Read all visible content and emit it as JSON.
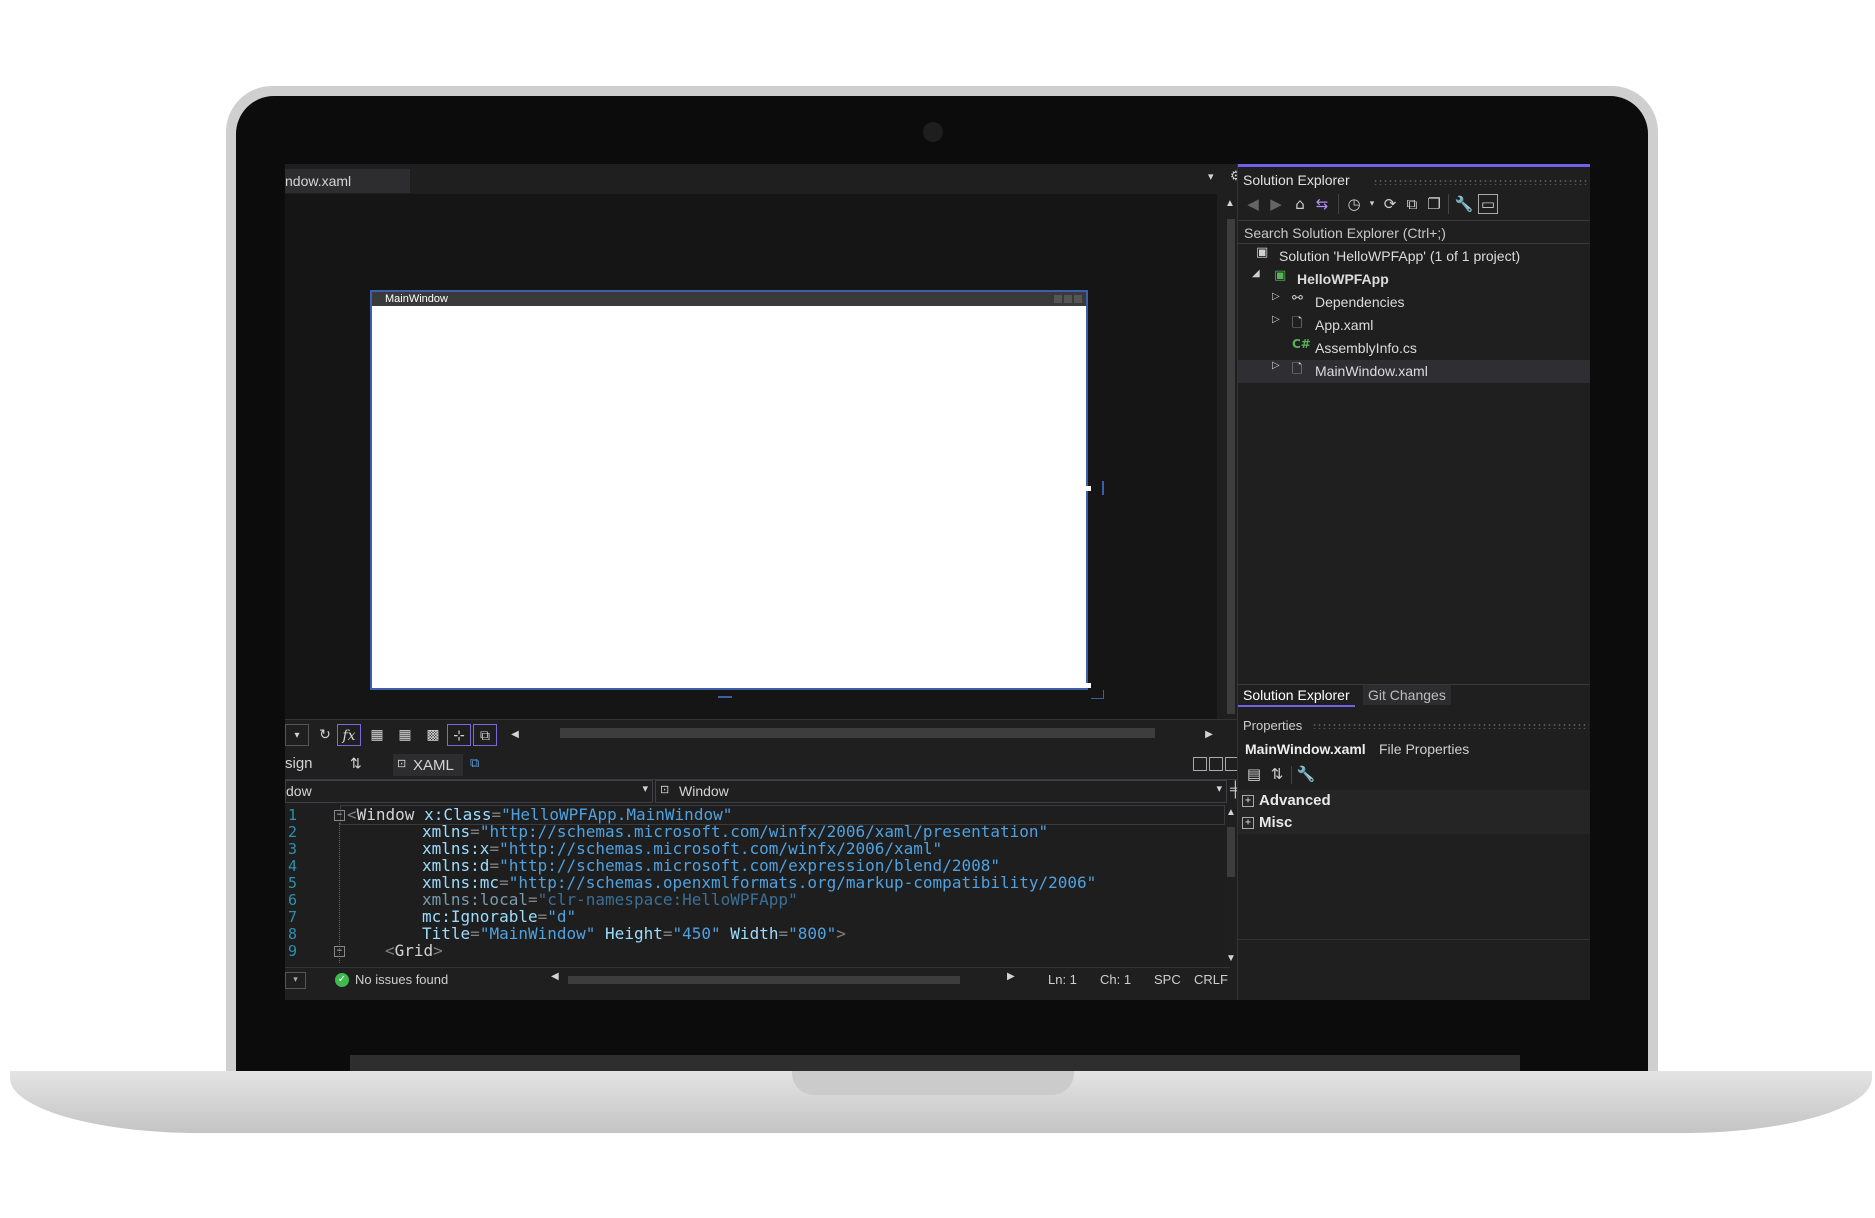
{
  "designer": {
    "doc_tab": "ndow.xaml",
    "preview_window_title": "MainWindow",
    "toolbar": {
      "zoom_dropdown": "▾",
      "refresh_icon": "↻",
      "fx_icon": "fx",
      "grid_icon_1": "▦",
      "grid_icon_2": "▦",
      "grid_icon_3": "▩",
      "snap_icon": "⊹",
      "artboard_icon": "⧉",
      "scroll_left": "◀",
      "scroll_right": "▶"
    },
    "split": {
      "design_tab": "sign",
      "swap_icon": "⇅",
      "xaml_tab": "XAML",
      "popout_icon": "⧉"
    },
    "nav": {
      "left_combo": "dow",
      "right_combo": "Window"
    }
  },
  "editor": {
    "lines": [
      {
        "n": "1"
      },
      {
        "n": "2"
      },
      {
        "n": "3"
      },
      {
        "n": "4"
      },
      {
        "n": "5"
      },
      {
        "n": "6"
      },
      {
        "n": "7"
      },
      {
        "n": "8"
      },
      {
        "n": "9"
      }
    ],
    "code": {
      "l1_tag": "Window",
      "l1_attr": "x:Class",
      "l1_val": "\"HelloWPFApp.MainWindow\"",
      "l2_attr": "xmlns",
      "l2_val": "\"http://schemas.microsoft.com/winfx/2006/xaml/presentation\"",
      "l3_attr": "xmlns:x",
      "l3_val": "\"http://schemas.microsoft.com/winfx/2006/xaml\"",
      "l4_attr": "xmlns:d",
      "l4_val": "\"http://schemas.microsoft.com/expression/blend/2008\"",
      "l5_attr": "xmlns:mc",
      "l5_val": "\"http://schemas.openxmlformats.org/markup-compatibility/2006\"",
      "l6_attr": "xmlns:local",
      "l6_val": "\"clr-namespace:HelloWPFApp\"",
      "l7_attr": "mc:Ignorable",
      "l7_val": "\"d\"",
      "l8_attr1": "Title",
      "l8_val1": "\"MainWindow\"",
      "l8_attr2": "Height",
      "l8_val2": "\"450\"",
      "l8_attr3": "Width",
      "l8_val3": "\"800\"",
      "l9_tag": "Grid"
    },
    "status": {
      "issues": "No issues found",
      "ln": "Ln: 1",
      "ch": "Ch: 1",
      "spc": "SPC",
      "crlf": "CRLF"
    }
  },
  "solution_explorer": {
    "title": "Solution Explorer",
    "search_placeholder": "Search Solution Explorer (Ctrl+;)",
    "items": [
      {
        "label": "Solution 'HelloWPFApp' (1 of 1 project)"
      },
      {
        "label": "HelloWPFApp"
      },
      {
        "label": "Dependencies"
      },
      {
        "label": "App.xaml"
      },
      {
        "label": "AssemblyInfo.cs"
      },
      {
        "label": "MainWindow.xaml"
      }
    ],
    "tabs": [
      "Solution Explorer",
      "Git Changes"
    ]
  },
  "properties": {
    "title": "Properties",
    "object_name": "MainWindow.xaml",
    "object_type": "File Properties",
    "categories": [
      "Advanced",
      "Misc"
    ]
  },
  "colors": {
    "accent": "#7160e8",
    "issues_ok": "#3fb950"
  }
}
